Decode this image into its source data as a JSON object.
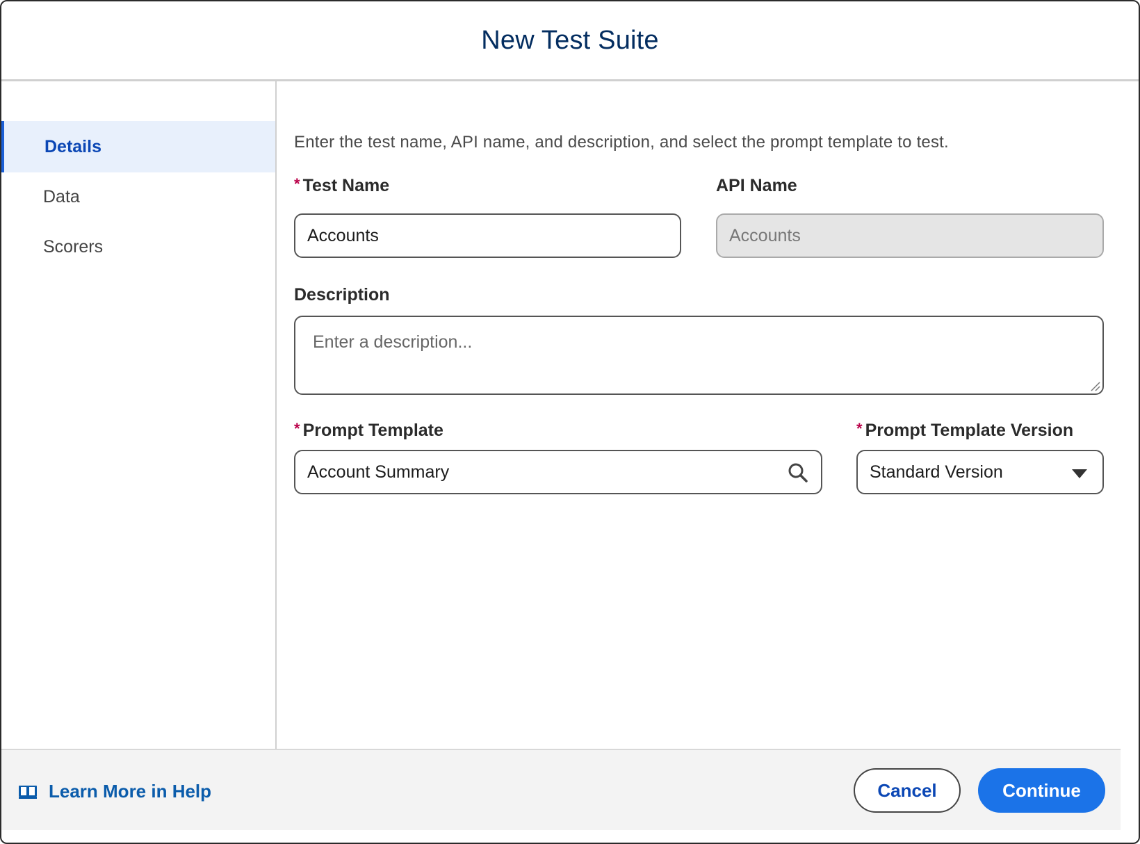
{
  "modal": {
    "title": "New Test Suite"
  },
  "sidebar": {
    "items": [
      {
        "label": "Details",
        "active": true
      },
      {
        "label": "Data",
        "active": false
      },
      {
        "label": "Scorers",
        "active": false
      }
    ]
  },
  "form": {
    "intro": "Enter the test name, API name, and description, and select the prompt template to test.",
    "required_marker": "*",
    "test_name": {
      "label": "Test Name",
      "value": "Accounts",
      "required": true
    },
    "api_name": {
      "label": "API Name",
      "value": "Accounts",
      "disabled": true
    },
    "description": {
      "label": "Description",
      "placeholder": "Enter a description..."
    },
    "prompt_template": {
      "label": "Prompt Template",
      "value": "Account Summary",
      "required": true,
      "icon": "search-icon"
    },
    "prompt_template_version": {
      "label": "Prompt Template Version",
      "value": "Standard Version",
      "required": true,
      "icon": "chevron-down-icon"
    }
  },
  "footer": {
    "help_label": "Learn More in Help",
    "help_icon": "book-icon",
    "cancel_label": "Cancel",
    "continue_label": "Continue"
  },
  "colors": {
    "title": "#032d60",
    "accent": "#1b73e8",
    "link": "#0b5cab",
    "required": "#ba0149",
    "active_nav_bg": "#e8f0fc"
  }
}
